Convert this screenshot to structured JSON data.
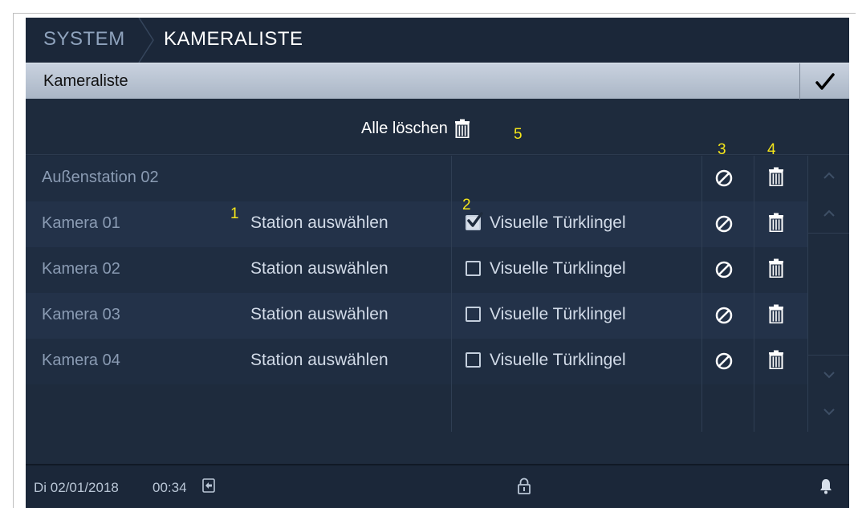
{
  "breadcrumb": {
    "root": "SYSTEM",
    "current": "KAMERALISTE"
  },
  "titlebar": {
    "title": "Kameraliste",
    "confirm_icon": "checkmark-icon"
  },
  "delete_all": {
    "label": "Alle löschen",
    "icon": "trash-icon"
  },
  "annotations": {
    "a1": "1",
    "a2": "2",
    "a3": "3",
    "a4": "4",
    "a5": "5"
  },
  "outdoor_station": {
    "name": "Außenstation 02",
    "block_icon": "block-icon",
    "trash_icon": "trash-icon"
  },
  "cameras": [
    {
      "name": "Kamera 01",
      "station": "Station auswählen",
      "visual": "Visuelle Türklingel",
      "checked": true
    },
    {
      "name": "Kamera 02",
      "station": "Station auswählen",
      "visual": "Visuelle Türklingel",
      "checked": false
    },
    {
      "name": "Kamera 03",
      "station": "Station auswählen",
      "visual": "Visuelle Türklingel",
      "checked": false
    },
    {
      "name": "Kamera 04",
      "station": "Station auswählen",
      "visual": "Visuelle Türklingel",
      "checked": false
    }
  ],
  "footer": {
    "date": "Di 02/01/2018",
    "time": "00:34"
  },
  "colors": {
    "background": "#1e2b3d",
    "titlebar": "#b7c2d1",
    "annotation": "#f5e61a",
    "text": "#d2dbe8"
  }
}
